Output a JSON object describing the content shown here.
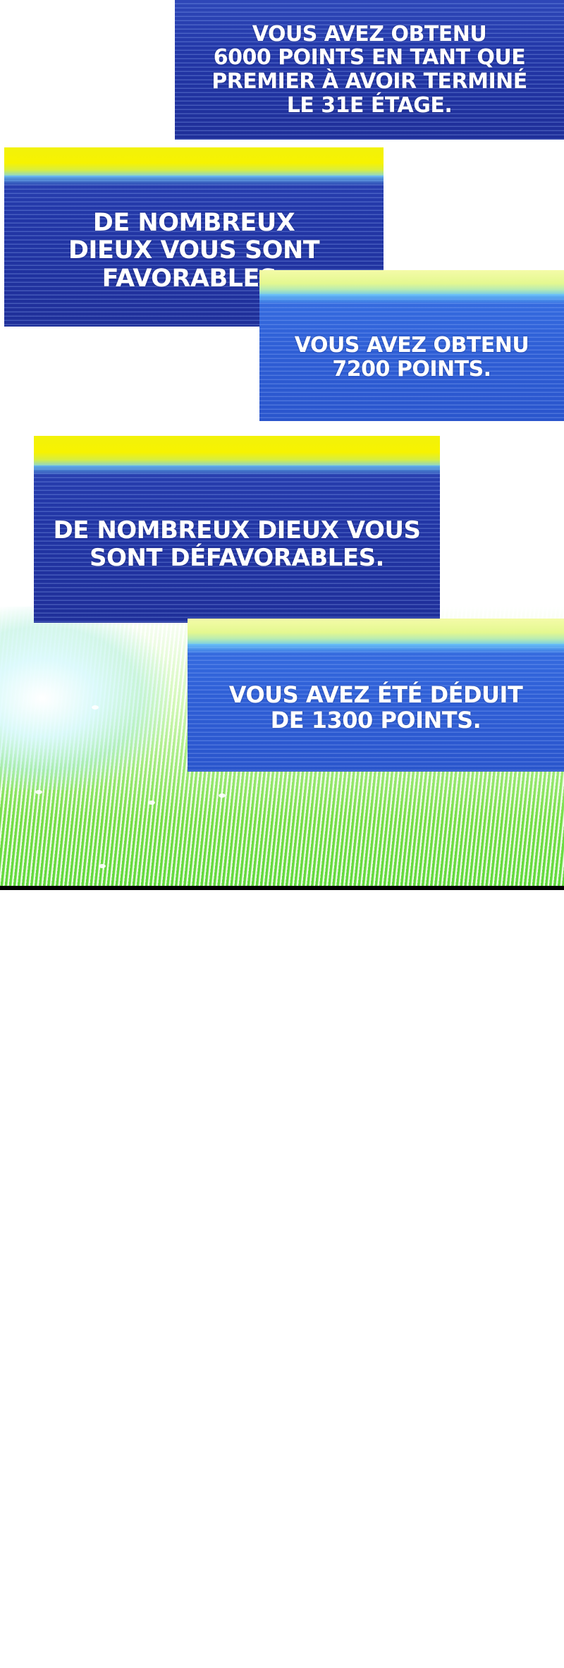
{
  "colors": {
    "window_dark": "#2236a6",
    "window_bright": "#2f5fd6",
    "window_header_yellow": "#f7f300",
    "burst_green": "#5fd93a",
    "text": "#ffffff"
  },
  "notifications": [
    {
      "id": "points-6000",
      "text": "VOUS AVEZ OBTENU\n6000 POINTS EN TANT QUE\nPREMIER À AVOIR TERMINÉ\nLE 31E ÉTAGE."
    },
    {
      "id": "gods-favorable",
      "text": "DE NOMBREUX\nDIEUX VOUS SONT\nFAVORABLES."
    },
    {
      "id": "points-7200",
      "text": "VOUS AVEZ OBTENU\n7200 POINTS."
    },
    {
      "id": "gods-unfavorable",
      "text": "DE NOMBREUX DIEUX VOUS\nSONT DÉFAVORABLES."
    },
    {
      "id": "points-deducted",
      "text": "VOUS AVEZ ÉTÉ DÉDUIT\nDE 1300 POINTS."
    }
  ]
}
